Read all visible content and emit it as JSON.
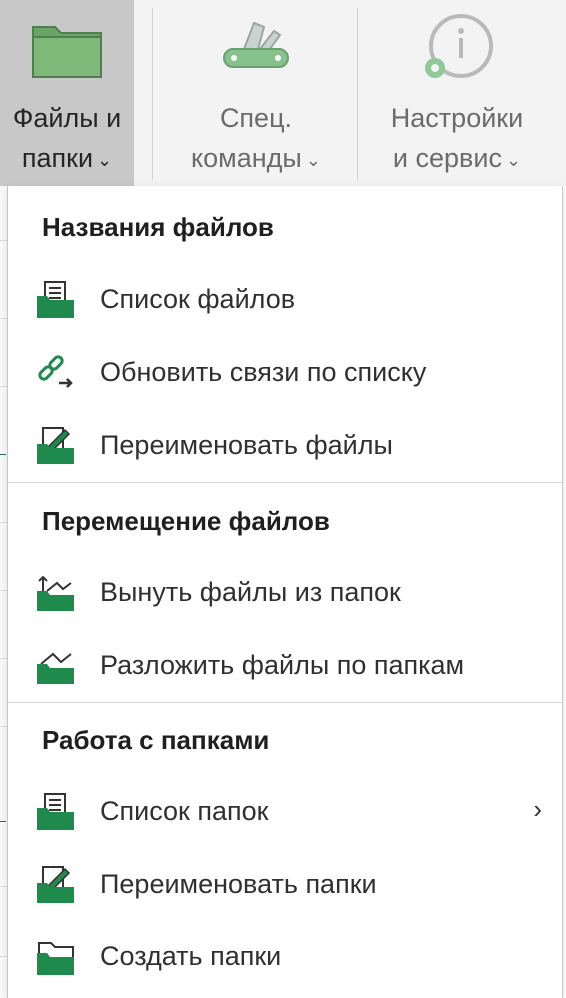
{
  "ribbon": {
    "buttons": [
      {
        "line1": "Файлы и",
        "line2": "папки",
        "icon": "folder-icon",
        "active": true
      },
      {
        "line1": "Спец.",
        "line2": "команды",
        "icon": "swiss-knife-icon",
        "active": false
      },
      {
        "line1": "Настройки",
        "line2": "и сервис",
        "icon": "info-gear-icon",
        "active": false
      }
    ],
    "caret": "⌄"
  },
  "menu": {
    "sections": [
      {
        "title": "Названия файлов",
        "items": [
          {
            "label": "Список файлов",
            "icon": "file-list-icon"
          },
          {
            "label": "Обновить связи по списку",
            "icon": "link-update-icon"
          },
          {
            "label": "Переименовать файлы",
            "icon": "rename-files-icon"
          }
        ]
      },
      {
        "title": "Перемещение файлов",
        "items": [
          {
            "label": "Вынуть файлы из папок",
            "icon": "extract-files-icon"
          },
          {
            "label": "Разложить файлы по папкам",
            "icon": "distribute-files-icon"
          }
        ]
      },
      {
        "title": "Работа с папками",
        "items": [
          {
            "label": "Список папок",
            "icon": "folder-list-icon",
            "submenu": "›"
          },
          {
            "label": "Переименовать папки",
            "icon": "rename-folders-icon"
          },
          {
            "label": "Создать папки",
            "icon": "create-folders-icon"
          }
        ]
      }
    ]
  },
  "colors": {
    "accent_green": "#1e8a4c",
    "active_button": "#c8c8c8",
    "ribbon_bg": "#f3f3f3"
  }
}
